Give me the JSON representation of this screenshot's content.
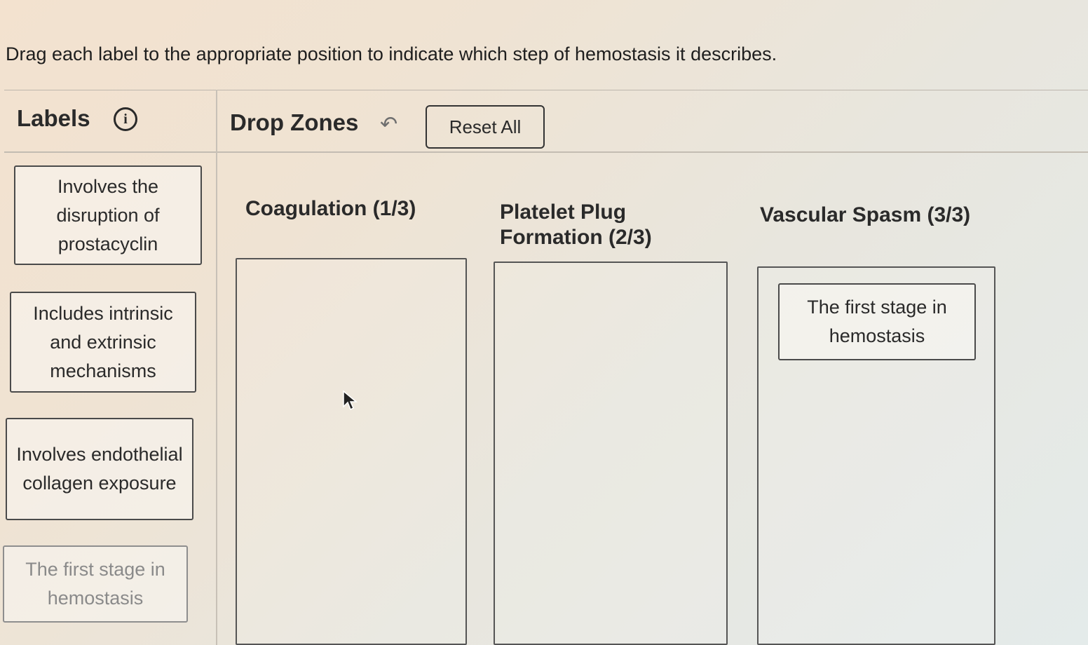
{
  "instruction": "Drag each label to the appropriate position to indicate which step of hemostasis it describes.",
  "labels_panel": {
    "heading": "Labels",
    "info_icon": "info-icon",
    "cards": [
      {
        "text": "Involves the disruption of prostacyclin",
        "state": "available"
      },
      {
        "text": "Includes intrinsic and extrinsic mechanisms",
        "state": "available"
      },
      {
        "text": "Involves endothelial collagen exposure",
        "state": "available"
      },
      {
        "text": "The first stage in hemostasis",
        "state": "placed"
      }
    ]
  },
  "zones_panel": {
    "heading": "Drop Zones",
    "undo_icon": "undo-icon",
    "reset_label": "Reset All",
    "zones": [
      {
        "title": "Coagulation (1/3)",
        "placed": []
      },
      {
        "title": "Platelet Plug Formation (2/3)",
        "placed": []
      },
      {
        "title": "Vascular Spasm (3/3)",
        "placed": [
          "The first stage in hemostasis"
        ]
      }
    ]
  }
}
